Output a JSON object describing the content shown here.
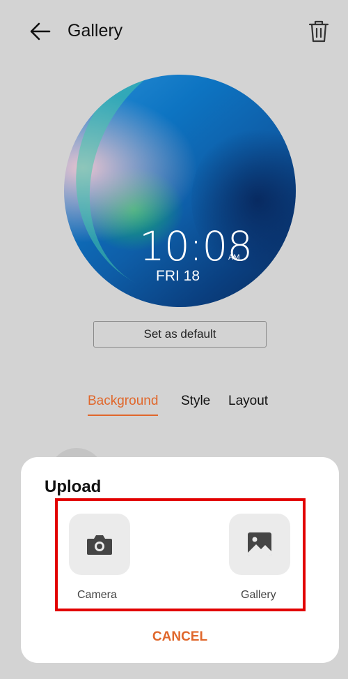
{
  "header": {
    "title": "Gallery"
  },
  "watch_preview": {
    "time": "10:08",
    "ampm": "AM",
    "date": "FRI 18"
  },
  "actions": {
    "set_default_label": "Set as default"
  },
  "tabs": [
    {
      "label": "Background",
      "selected": true
    },
    {
      "label": "Style",
      "selected": false
    },
    {
      "label": "Layout",
      "selected": false
    }
  ],
  "upload_sheet": {
    "title": "Upload",
    "options": [
      {
        "label": "Camera",
        "icon": "camera-icon"
      },
      {
        "label": "Gallery",
        "icon": "image-icon"
      }
    ],
    "cancel_label": "CANCEL"
  },
  "colors": {
    "accent": "#e0672b",
    "highlight": "#e20000",
    "background": "#d3d3d3"
  }
}
